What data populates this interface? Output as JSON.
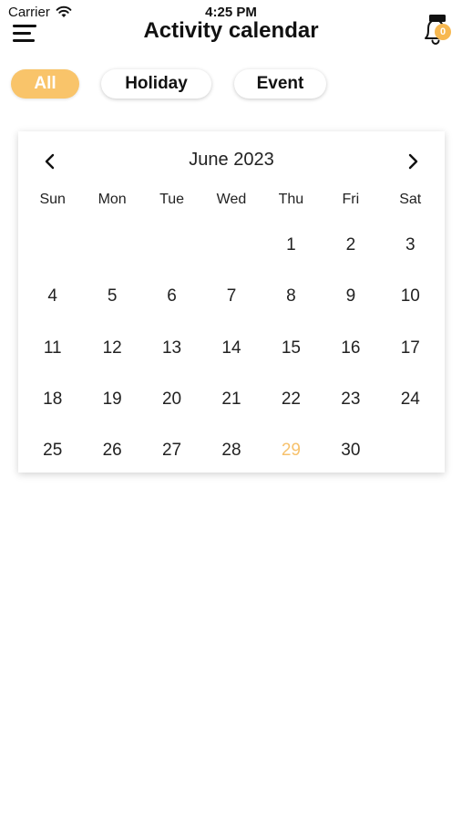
{
  "status_bar": {
    "carrier": "Carrier",
    "time": "4:25 PM"
  },
  "header": {
    "title": "Activity calendar",
    "notification_count": "0"
  },
  "filters": [
    {
      "label": "All",
      "active": true
    },
    {
      "label": "Holiday",
      "active": false
    },
    {
      "label": "Event",
      "active": false
    }
  ],
  "calendar": {
    "month_label": "June 2023",
    "weekdays": [
      "Sun",
      "Mon",
      "Tue",
      "Wed",
      "Thu",
      "Fri",
      "Sat"
    ],
    "leading_blank_days": 4,
    "days": [
      "1",
      "2",
      "3",
      "4",
      "5",
      "6",
      "7",
      "8",
      "9",
      "10",
      "11",
      "12",
      "13",
      "14",
      "15",
      "16",
      "17",
      "18",
      "19",
      "20",
      "21",
      "22",
      "23",
      "24",
      "25",
      "26",
      "27",
      "28",
      "29",
      "30"
    ],
    "highlighted_day": "29"
  },
  "colors": {
    "accent": "#f9c46a",
    "highlight_text": "#f7c26d",
    "badge": "#f7b850",
    "text": "#111111"
  },
  "icons": {
    "menu": "menu-icon",
    "bell": "bell-icon",
    "prev": "chevron-left-icon",
    "next": "chevron-right-icon",
    "wifi": "wifi-icon",
    "battery": "battery-icon"
  }
}
